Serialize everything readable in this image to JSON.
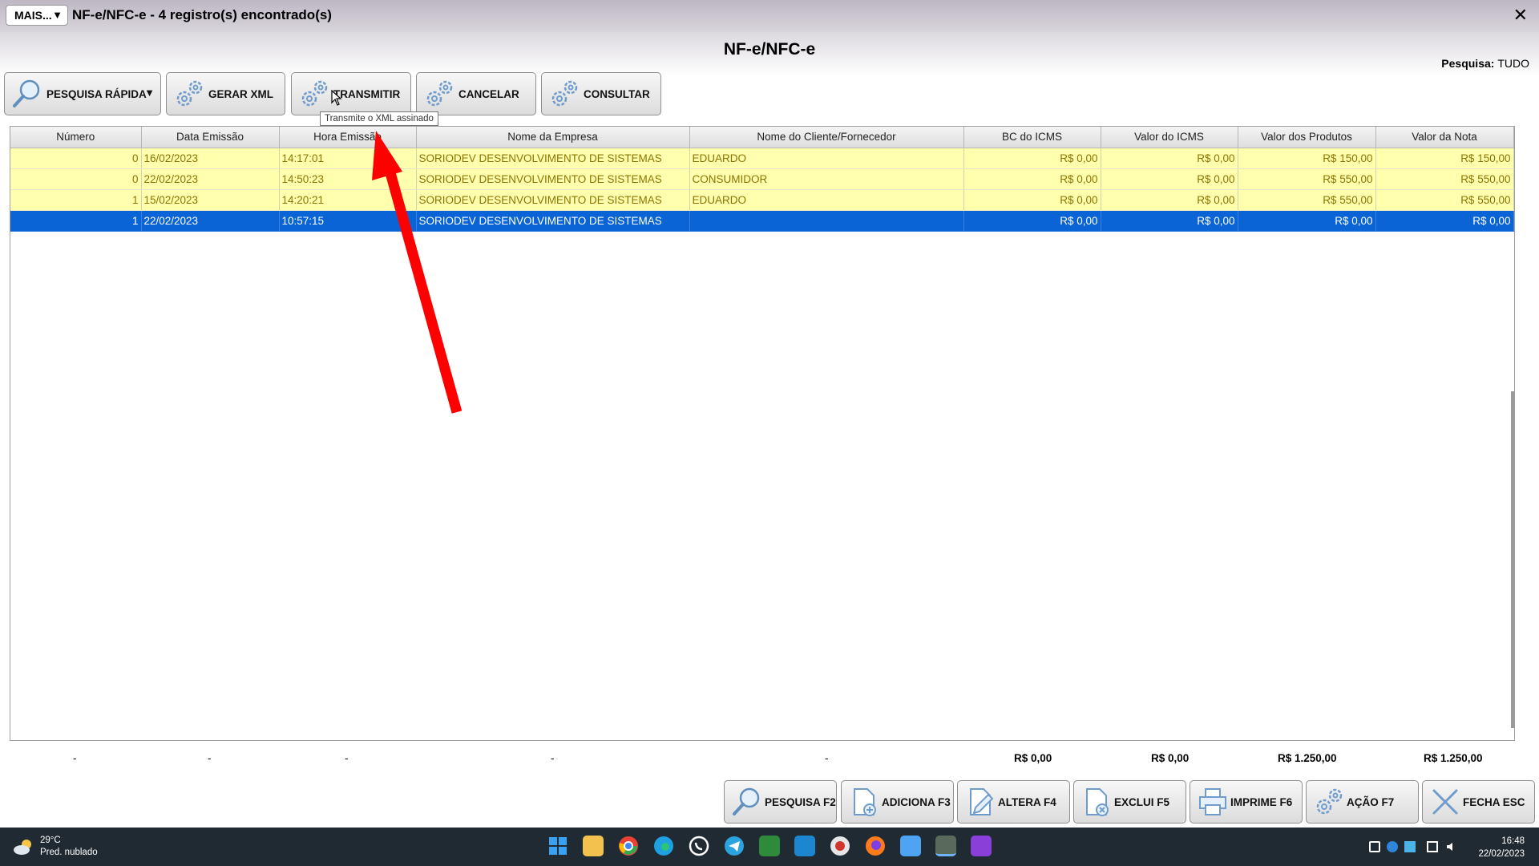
{
  "window": {
    "mais_label": "MAIS...",
    "mais_caret": "▼",
    "title": "NF-e/NFC-e - 4 registro(s) encontrado(s)",
    "close_glyph": "✕"
  },
  "header": {
    "page_title": "NF-e/NFC-e",
    "search_scope_label": "Pesquisa:",
    "search_scope_value": "TUDO"
  },
  "toolbar": {
    "quick_search": "PESQUISA RÁPIDA",
    "quick_search_caret": "▼",
    "generate_xml": "GERAR XML",
    "transmit": "TRANSMITIR",
    "cancel": "CANCELAR",
    "query": "CONSULTAR",
    "transmit_tooltip": "Transmite o XML assinado"
  },
  "grid": {
    "columns": [
      "Número",
      "Data Emissão",
      "Hora Emissão",
      "Nome da Empresa",
      "Nome do Cliente/Fornecedor",
      "BC do ICMS",
      "Valor do ICMS",
      "Valor dos Produtos",
      "Valor da Nota"
    ],
    "rows": [
      {
        "numero": "0",
        "data": "16/02/2023",
        "hora": "14:17:01",
        "empresa": "SORIODEV DESENVOLVIMENTO DE SISTEMAS",
        "cliente": "EDUARDO",
        "bc_icms": "R$ 0,00",
        "valor_icms": "R$ 0,00",
        "valor_produtos": "R$ 150,00",
        "valor_nota": "R$ 150,00",
        "selected": false
      },
      {
        "numero": "0",
        "data": "22/02/2023",
        "hora": "14:50:23",
        "empresa": "SORIODEV DESENVOLVIMENTO DE SISTEMAS",
        "cliente": "CONSUMIDOR",
        "bc_icms": "R$ 0,00",
        "valor_icms": "R$ 0,00",
        "valor_produtos": "R$ 550,00",
        "valor_nota": "R$ 550,00",
        "selected": false
      },
      {
        "numero": "1",
        "data": "15/02/2023",
        "hora": "14:20:21",
        "empresa": "SORIODEV DESENVOLVIMENTO DE SISTEMAS",
        "cliente": "EDUARDO",
        "bc_icms": "R$ 0,00",
        "valor_icms": "R$ 0,00",
        "valor_produtos": "R$ 550,00",
        "valor_nota": "R$ 550,00",
        "selected": false
      },
      {
        "numero": "1",
        "data": "22/02/2023",
        "hora": "10:57:15",
        "empresa": "SORIODEV DESENVOLVIMENTO DE SISTEMAS",
        "cliente": "",
        "bc_icms": "R$ 0,00",
        "valor_icms": "R$ 0,00",
        "valor_produtos": "R$ 0,00",
        "valor_nota": "R$ 0,00",
        "selected": true
      }
    ]
  },
  "totals": {
    "numero": "-",
    "data": "-",
    "hora": "-",
    "empresa": "-",
    "cliente": "-",
    "bc_icms": "R$ 0,00",
    "valor_icms": "R$ 0,00",
    "valor_produtos": "R$ 1.250,00",
    "valor_nota": "R$ 1.250,00"
  },
  "footer_buttons": {
    "search": "PESQUISA F2",
    "add": "ADICIONA F3",
    "edit": "ALTERA F4",
    "delete": "EXCLUI F5",
    "print": "IMPRIME F6",
    "action": "AÇÃO F7",
    "close": "FECHA ESC"
  },
  "taskbar": {
    "temperature": "29°C",
    "weather": "Pred. nublado",
    "time": "16:48",
    "date": "22/02/2023"
  },
  "colors": {
    "row_highlight": "#ffffae",
    "row_text": "#8b7500",
    "row_selected": "#0a64d6",
    "annotation_arrow": "#ff0000"
  }
}
